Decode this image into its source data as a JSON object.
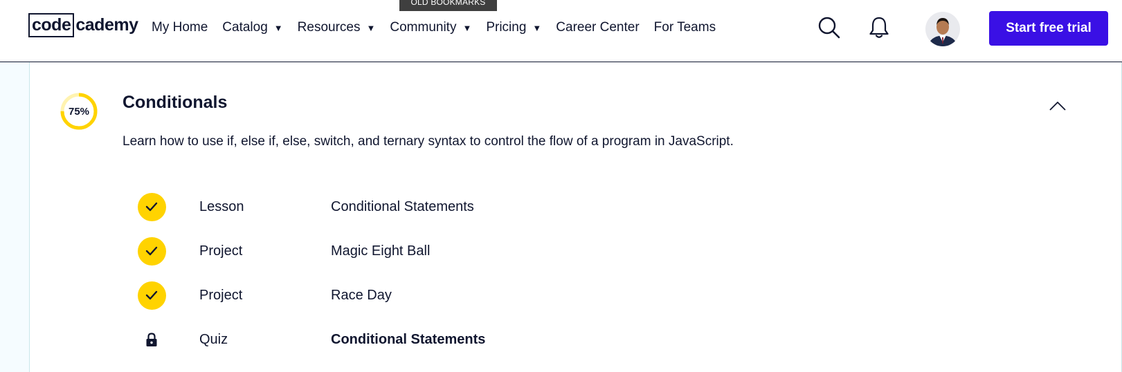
{
  "tooltip": "OLD BOOKMARKS",
  "logo": {
    "boxed": "code",
    "rest": "cademy"
  },
  "nav": [
    {
      "label": "My Home",
      "dropdown": false
    },
    {
      "label": "Catalog",
      "dropdown": true
    },
    {
      "label": "Resources",
      "dropdown": true
    },
    {
      "label": "Community",
      "dropdown": true
    },
    {
      "label": "Pricing",
      "dropdown": true
    },
    {
      "label": "Career Center",
      "dropdown": false
    },
    {
      "label": "For Teams",
      "dropdown": false
    }
  ],
  "header": {
    "cta_label": "Start free trial",
    "icons": [
      "search-icon",
      "bell-icon",
      "avatar"
    ]
  },
  "module": {
    "progress": 0.75,
    "progress_label": "75%",
    "title": "Conditionals",
    "description": "Learn how to use if, else if, else, switch, and ternary syntax to control the flow of a program in JavaScript.",
    "items": [
      {
        "type": "Lesson",
        "name": "Conditional Statements",
        "status": "complete"
      },
      {
        "type": "Project",
        "name": "Magic Eight Ball",
        "status": "complete"
      },
      {
        "type": "Project",
        "name": "Race Day",
        "status": "complete"
      },
      {
        "type": "Quiz",
        "name": "Conditional Statements",
        "status": "locked"
      }
    ]
  },
  "colors": {
    "accent": "#3a10e5",
    "progress": "#ffd300",
    "text": "#10162f",
    "page_bg": "#f5fcff"
  }
}
